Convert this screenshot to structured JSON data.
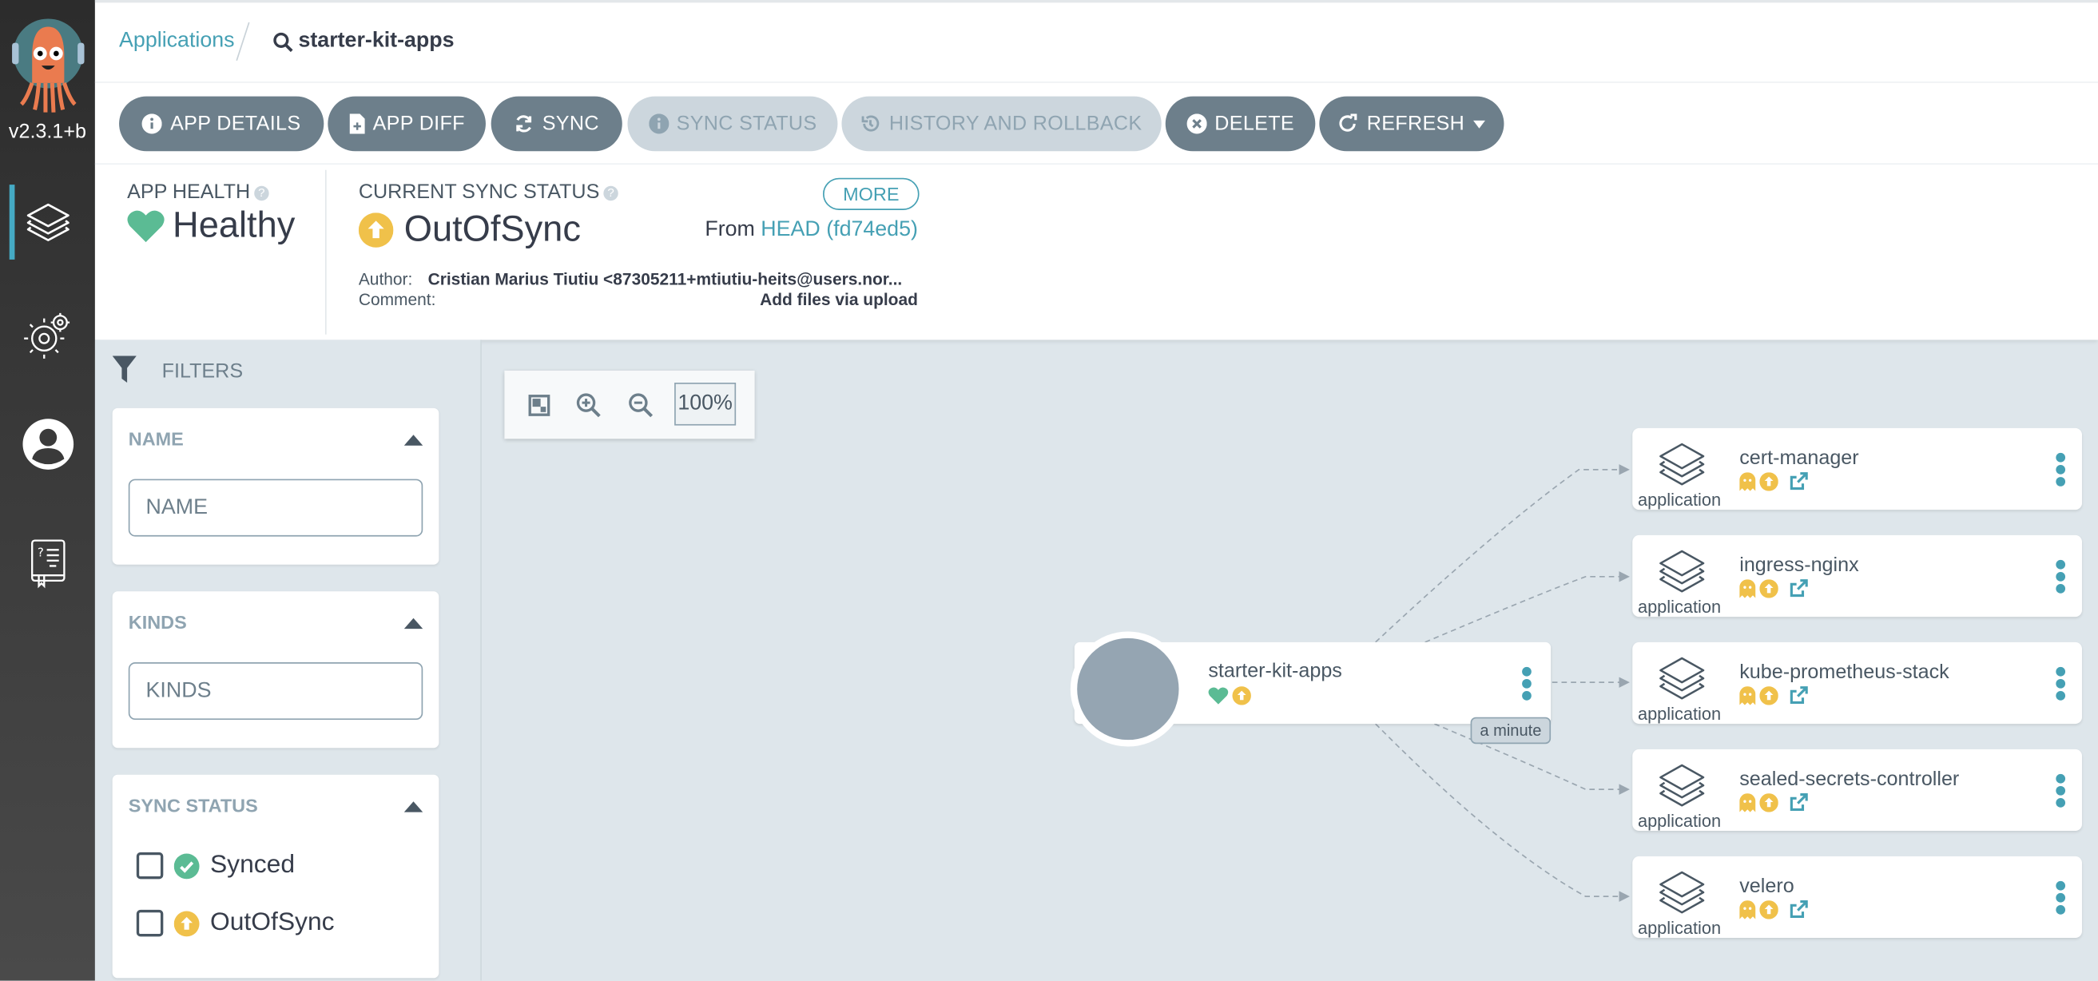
{
  "sidebar": {
    "version": "v2.3.1+b",
    "items": [
      {
        "name": "applications",
        "icon": "layers-icon",
        "active": true
      },
      {
        "name": "settings",
        "icon": "gears-icon",
        "active": false
      },
      {
        "name": "user-info",
        "icon": "user-circle-icon",
        "active": false
      },
      {
        "name": "documentation",
        "icon": "help-book-icon",
        "active": false
      }
    ]
  },
  "breadcrumb": {
    "parent": "Applications",
    "current": "starter-kit-apps"
  },
  "toolbar": {
    "buttons": [
      {
        "label": "APP DETAILS",
        "icon": "info-icon",
        "enabled": true
      },
      {
        "label": "APP DIFF",
        "icon": "file-diff-icon",
        "enabled": true
      },
      {
        "label": "SYNC",
        "icon": "sync-icon",
        "enabled": true
      },
      {
        "label": "SYNC STATUS",
        "icon": "info-icon",
        "enabled": false
      },
      {
        "label": "HISTORY AND ROLLBACK",
        "icon": "history-icon",
        "enabled": false
      },
      {
        "label": "DELETE",
        "icon": "times-circle-icon",
        "enabled": true
      },
      {
        "label": "REFRESH",
        "icon": "redo-icon",
        "enabled": true,
        "dropdown": true
      }
    ]
  },
  "status": {
    "health_label": "APP HEALTH",
    "health_value": "Healthy",
    "sync_label": "CURRENT SYNC STATUS",
    "sync_value": "OutOfSync",
    "more_label": "MORE",
    "from_prefix": "From",
    "revision": "HEAD (fd74ed5)",
    "author_label": "Author:",
    "author_value": "Cristian Marius Tiutiu <87305211+mtiutiu-heits@users.nor...",
    "comment_label": "Comment:",
    "comment_value": "Add files via upload"
  },
  "filters": {
    "title": "FILTERS",
    "name_section": {
      "title": "NAME",
      "placeholder": "NAME",
      "value": ""
    },
    "kinds_section": {
      "title": "KINDS",
      "placeholder": "KINDS",
      "value": ""
    },
    "sync_section": {
      "title": "SYNC STATUS",
      "options": [
        {
          "label": "Synced",
          "checked": false,
          "icon": "check-circle-icon"
        },
        {
          "label": "OutOfSync",
          "checked": false,
          "icon": "arrow-up-circle-icon"
        }
      ]
    }
  },
  "graph": {
    "zoom_level": "100%",
    "root": {
      "name": "starter-kit-apps",
      "health": "Healthy",
      "sync": "OutOfSync",
      "age": "a minute"
    },
    "children": [
      {
        "name": "cert-manager",
        "kind": "application",
        "health": "Missing",
        "sync": "OutOfSync"
      },
      {
        "name": "ingress-nginx",
        "kind": "application",
        "health": "Missing",
        "sync": "OutOfSync"
      },
      {
        "name": "kube-prometheus-stack",
        "kind": "application",
        "health": "Missing",
        "sync": "OutOfSync"
      },
      {
        "name": "sealed-secrets-controller",
        "kind": "application",
        "health": "Missing",
        "sync": "OutOfSync"
      },
      {
        "name": "velero",
        "kind": "application",
        "health": "Missing",
        "sync": "OutOfSync"
      }
    ]
  },
  "colors": {
    "accent": "#45a0b4",
    "healthy": "#5bbb94",
    "outofsync": "#f0c14a",
    "button": "#6d7f8b",
    "button_disabled": "#ccd6dd",
    "sidebar": "#333333"
  }
}
